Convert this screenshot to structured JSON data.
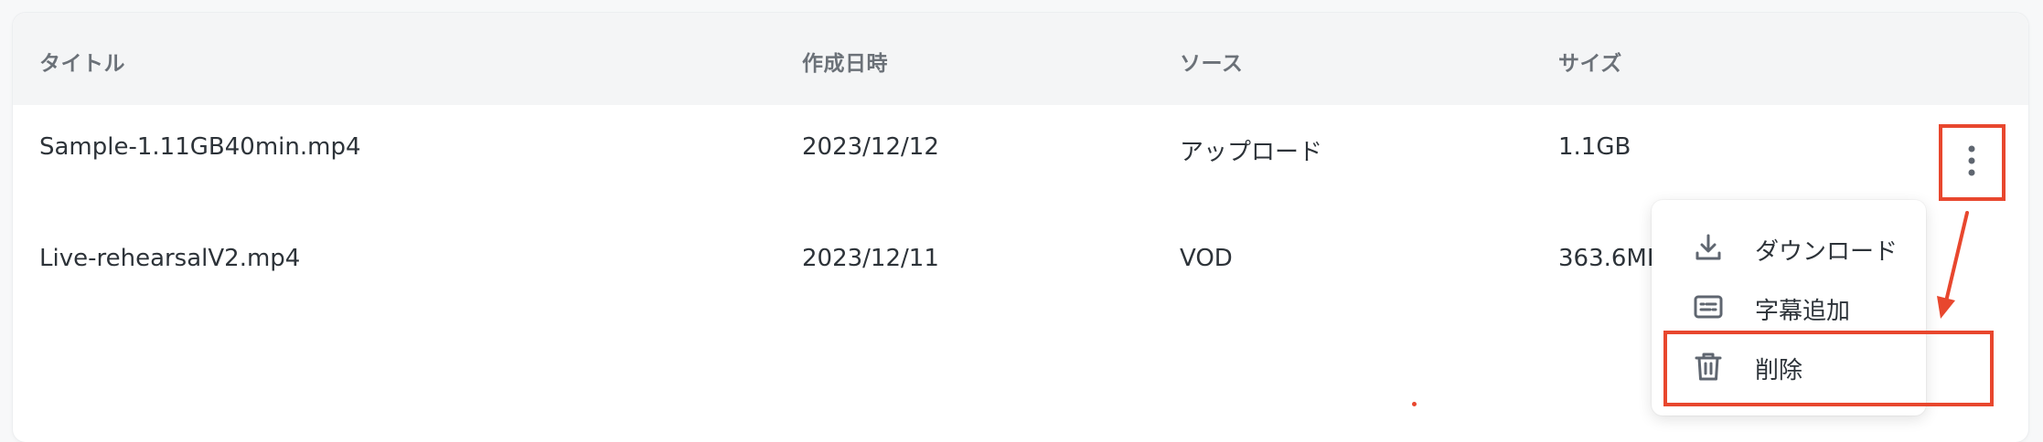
{
  "table": {
    "headers": {
      "title": "タイトル",
      "created": "作成日時",
      "source": "ソース",
      "size": "サイズ"
    },
    "rows": [
      {
        "title": "Sample-1.11GB40min.mp4",
        "created": "2023/12/12",
        "source": "アップロード",
        "size": "1.1GB"
      },
      {
        "title": "Live-rehearsalV2.mp4",
        "created": "2023/12/11",
        "source": "VOD",
        "size": "363.6MI"
      }
    ]
  },
  "row_menu": {
    "items": [
      {
        "label": "ダウンロード",
        "icon": "download-icon"
      },
      {
        "label": "字幕追加",
        "icon": "subtitles-icon"
      },
      {
        "label": "削除",
        "icon": "trash-icon"
      }
    ]
  },
  "annotation": {
    "highlight_color": "#e8472e"
  },
  "colors": {
    "header_bg": "#f4f5f6",
    "header_text": "#6b7178",
    "body_text": "#2d3339",
    "icon": "#5f6670"
  }
}
